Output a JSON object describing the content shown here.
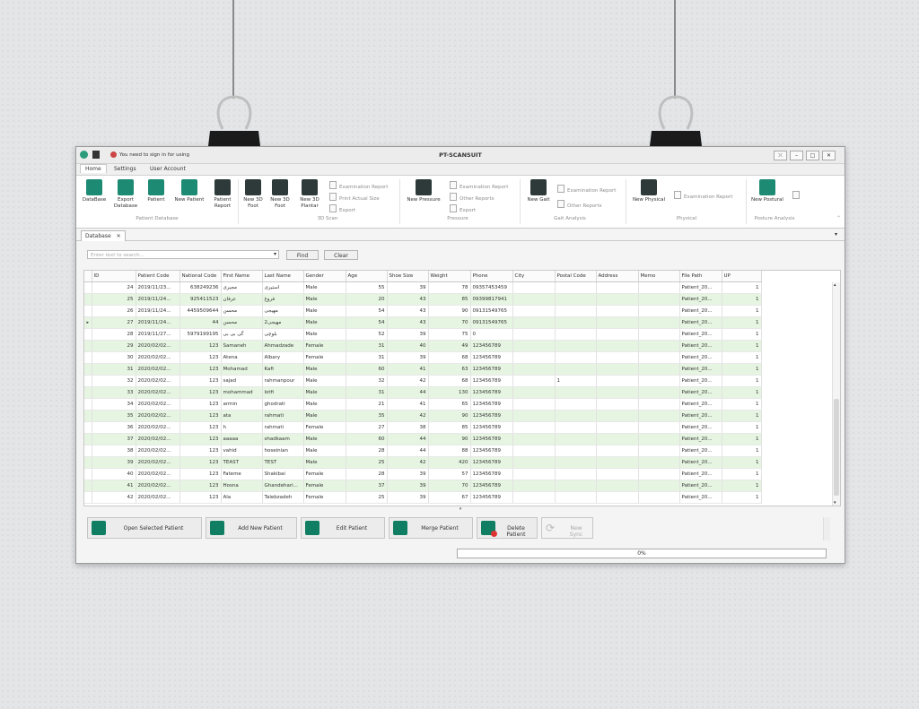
{
  "window": {
    "title": "PT-SCANSUIT",
    "signin_notice": "You need to sign in for using"
  },
  "menu": {
    "tabs": [
      "Home",
      "Settings",
      "User Account"
    ]
  },
  "ribbon": {
    "patient_database": {
      "group": "Patient Database",
      "buttons": [
        "DataBase",
        "Export\nDatabase",
        "Patient",
        "New Patient",
        "Patient\nReport"
      ]
    },
    "scan3d": {
      "group": "3D Scan",
      "buttons": [
        "New 3D\nFoot",
        "New 3D\nFoot",
        "New 3D\nPlantar"
      ],
      "small": [
        "Examination Report",
        "Print Actual Size",
        "Export"
      ]
    },
    "pressure": {
      "group": "Pressure",
      "button": "New Pressure",
      "small": [
        "Examination Report",
        "Other Reports",
        "Export"
      ]
    },
    "gait": {
      "group": "Gait Analysis",
      "button": "New Gait",
      "small": [
        "Examination Report",
        "Other Reports"
      ]
    },
    "physical": {
      "group": "Physical",
      "button": "New Physical",
      "small": [
        "Examination Report"
      ]
    },
    "postural": {
      "group": "Posture Analysis",
      "button": "New Postural"
    }
  },
  "doc_tab": {
    "label": "Database",
    "close": "✕"
  },
  "search": {
    "placeholder": "Enter text to search...",
    "find": "Find",
    "clear": "Clear"
  },
  "table": {
    "columns": [
      "ID",
      "Patient Code",
      "National Code",
      "First Name",
      "Last Name",
      "Gender",
      "Age",
      "Shoe Size",
      "Weight",
      "Phone",
      "City",
      "Postal Code",
      "Address",
      "Memo",
      "File Path",
      "UP"
    ],
    "rows": [
      [
        "24",
        "2019/11/23...",
        "638249236",
        "مجیری",
        "استیری",
        "Male",
        "55",
        "39",
        "78",
        "09357453459",
        "",
        "",
        "",
        "",
        "Patient_20...",
        "1"
      ],
      [
        "25",
        "2019/11/24...",
        "925411523",
        "عرفان",
        "فروغ",
        "Male",
        "20",
        "43",
        "85",
        "09399817941",
        "",
        "",
        "",
        "",
        "Patient_20...",
        "1"
      ],
      [
        "26",
        "2019/11/24...",
        "4459509644",
        "محسن",
        "مهیجی",
        "Male",
        "54",
        "43",
        "90",
        "09131549765",
        "",
        "",
        "",
        "",
        "Patient_20...",
        "1"
      ],
      [
        "27",
        "2019/11/24...",
        "44",
        "محسن",
        "مهیجی2",
        "Male",
        "54",
        "43",
        "70",
        "09131549765",
        "",
        "",
        "",
        "",
        "Patient_20...",
        "1"
      ],
      [
        "28",
        "2019/11/27...",
        "5979199195",
        "گی بی بی",
        "بلوچی",
        "Male",
        "52",
        "39",
        "75",
        "0",
        "",
        "",
        "",
        "",
        "Patient_20...",
        "1"
      ],
      [
        "29",
        "2020/02/02...",
        "123",
        "Samaneh",
        "Ahmadzade",
        "Female",
        "31",
        "40",
        "49",
        "123456789",
        "",
        "",
        "",
        "",
        "Patient_20...",
        "1"
      ],
      [
        "30",
        "2020/02/02...",
        "123",
        "Atena",
        "Albary",
        "Female",
        "31",
        "39",
        "68",
        "123456789",
        "",
        "",
        "",
        "",
        "Patient_20...",
        "1"
      ],
      [
        "31",
        "2020/02/02...",
        "123",
        "Mohamad",
        "Kafi",
        "Male",
        "60",
        "41",
        "63",
        "123456789",
        "",
        "",
        "",
        "",
        "Patient_20...",
        "1"
      ],
      [
        "32",
        "2020/02/02...",
        "123",
        "sajad",
        "rahmanpour",
        "Male",
        "32",
        "42",
        "68",
        "123456789",
        "",
        "1",
        "",
        "",
        "Patient_20...",
        "1"
      ],
      [
        "33",
        "2020/02/02...",
        "123",
        "mohammad",
        "lotfi",
        "Male",
        "31",
        "44",
        "130",
        "123456789",
        "",
        "",
        "",
        "",
        "Patient_20...",
        "1"
      ],
      [
        "34",
        "2020/02/02...",
        "123",
        "armin",
        "ghodrati",
        "Male",
        "21",
        "41",
        "65",
        "123456789",
        "",
        "",
        "",
        "",
        "Patient_20...",
        "1"
      ],
      [
        "35",
        "2020/02/02...",
        "123",
        "ata",
        "rahmati",
        "Male",
        "35",
        "42",
        "90",
        "123456789",
        "",
        "",
        "",
        "",
        "Patient_20...",
        "1"
      ],
      [
        "36",
        "2020/02/02...",
        "123",
        "h",
        "rahmati",
        "Female",
        "27",
        "38",
        "85",
        "123456789",
        "",
        "",
        "",
        "",
        "Patient_20...",
        "1"
      ],
      [
        "37",
        "2020/02/02...",
        "123",
        "aaaaa",
        "shadkaam",
        "Male",
        "60",
        "44",
        "90",
        "123456789",
        "",
        "",
        "",
        "",
        "Patient_20...",
        "1"
      ],
      [
        "38",
        "2020/02/02...",
        "123",
        "vahid",
        "hoseinian",
        "Male",
        "28",
        "44",
        "88",
        "123456789",
        "",
        "",
        "",
        "",
        "Patient_20...",
        "1"
      ],
      [
        "39",
        "2020/02/02...",
        "123",
        "TEAST",
        "TEST",
        "Male",
        "25",
        "42",
        "420",
        "123456789",
        "",
        "",
        "",
        "",
        "Patient_20...",
        "1"
      ],
      [
        "40",
        "2020/02/02...",
        "123",
        "Fateme",
        "Shakibai",
        "Female",
        "28",
        "39",
        "57",
        "123456789",
        "",
        "",
        "",
        "",
        "Patient_20...",
        "1"
      ],
      [
        "41",
        "2020/02/02...",
        "123",
        "Hosna",
        "Ghandehari...",
        "Female",
        "37",
        "39",
        "70",
        "123456789",
        "",
        "",
        "",
        "",
        "Patient_20...",
        "1"
      ],
      [
        "42",
        "2020/02/02...",
        "123",
        "Ala",
        "Talebzadeh",
        "Female",
        "25",
        "39",
        "67",
        "123456789",
        "",
        "",
        "",
        "",
        "Patient_20...",
        "1"
      ]
    ],
    "current_row_marker": "▸"
  },
  "actions": [
    "Open Selected Patient",
    "Add New Patient",
    "Edit Patient",
    "Merge Patient",
    "Delete Patient",
    "New Sync"
  ],
  "progress": {
    "value": 0,
    "label": "0%"
  },
  "splitter_glyph": "▾"
}
